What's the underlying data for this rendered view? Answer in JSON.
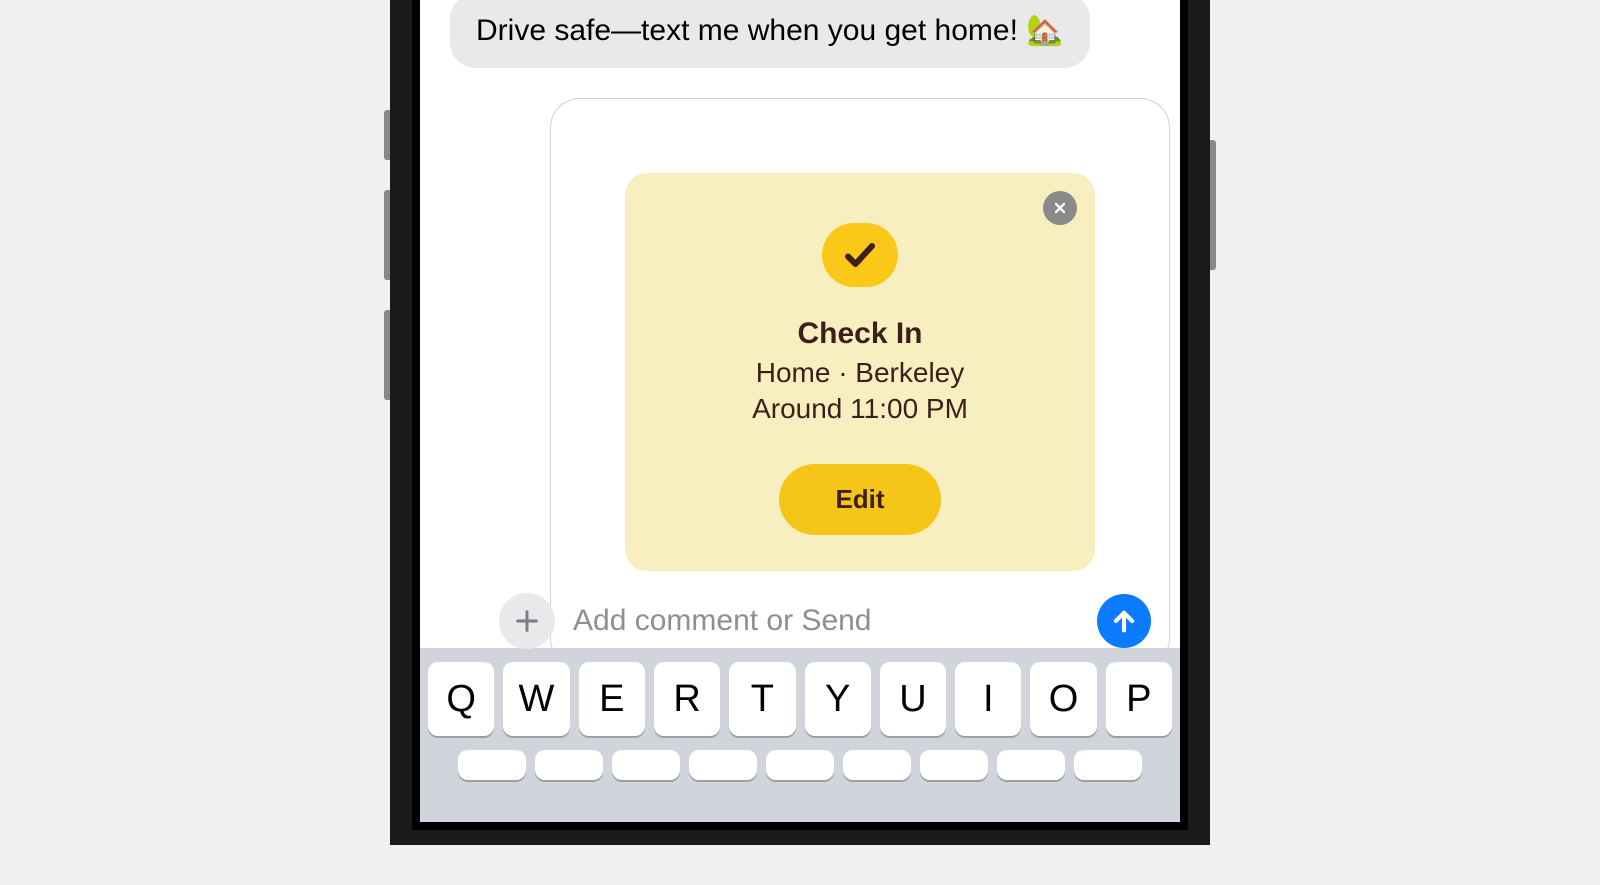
{
  "message": {
    "text": "Drive safe—text me when you get home! 🏡"
  },
  "checkin": {
    "title": "Check In",
    "location": "Home · Berkeley",
    "time": "Around 11:00 PM",
    "edit_label": "Edit"
  },
  "input": {
    "placeholder": "Add comment or Send"
  },
  "keyboard": {
    "row1": [
      "Q",
      "W",
      "E",
      "R",
      "T",
      "Y",
      "U",
      "I",
      "O",
      "P"
    ]
  }
}
